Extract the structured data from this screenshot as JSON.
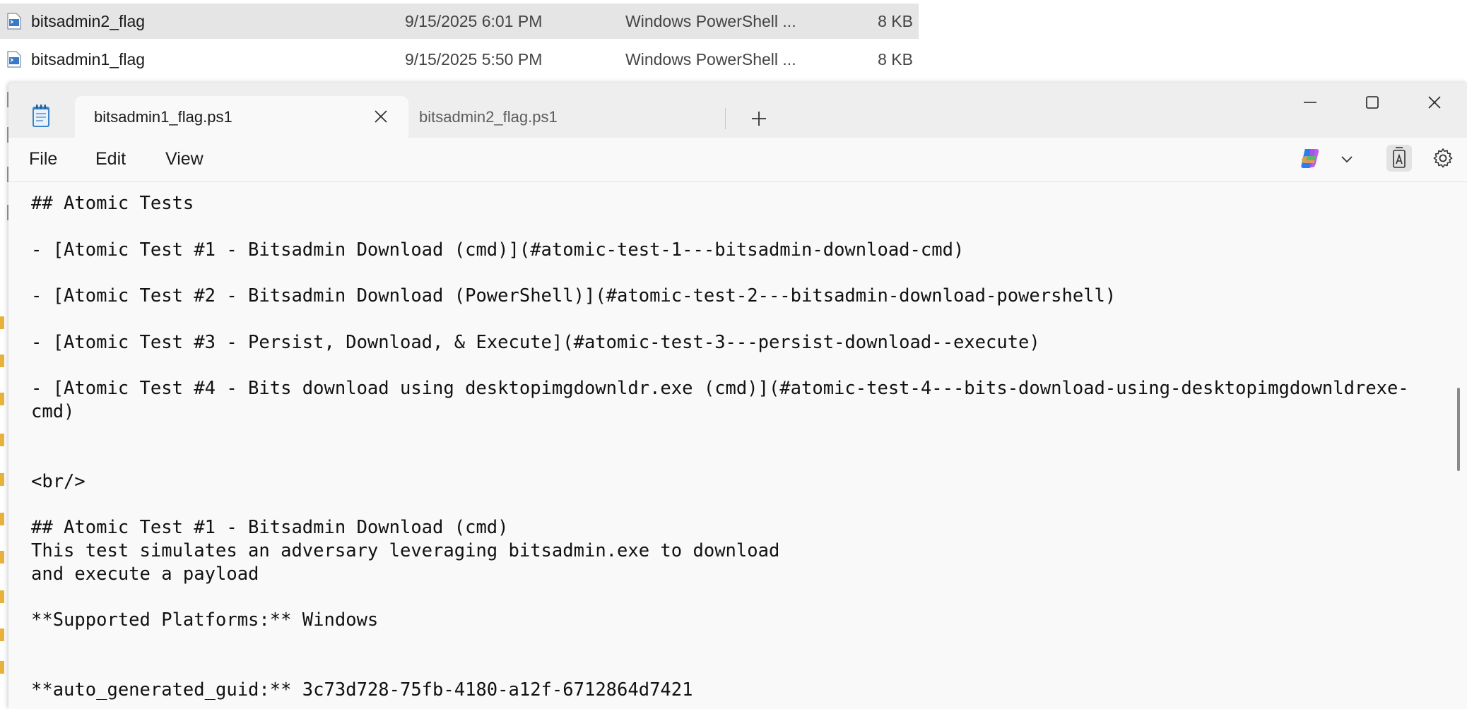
{
  "explorer": {
    "files": [
      {
        "name": "bitsadmin2_flag",
        "date": "9/15/2025 6:01 PM",
        "type": "Windows PowerShell ...",
        "size": "8 KB",
        "selected": true
      },
      {
        "name": "bitsadmin1_flag",
        "date": "9/15/2025 5:50 PM",
        "type": "Windows PowerShell ...",
        "size": "8 KB",
        "selected": false
      }
    ]
  },
  "notepad": {
    "tabs": [
      {
        "label": "bitsadmin1_flag.ps1",
        "active": true
      },
      {
        "label": "bitsadmin2_flag.ps1",
        "active": false
      }
    ],
    "menu": {
      "file": "File",
      "edit": "Edit",
      "view": "View"
    },
    "content": [
      "## Atomic Tests",
      "",
      "- [Atomic Test #1 - Bitsadmin Download (cmd)](#atomic-test-1---bitsadmin-download-cmd)",
      "",
      "- [Atomic Test #2 - Bitsadmin Download (PowerShell)](#atomic-test-2---bitsadmin-download-powershell)",
      "",
      "- [Atomic Test #3 - Persist, Download, & Execute](#atomic-test-3---persist-download--execute)",
      "",
      "- [Atomic Test #4 - Bits download using desktopimgdownldr.exe (cmd)](#atomic-test-4---bits-download-using-desktopimgdownldrexe-",
      "cmd)",
      "",
      "",
      "<br/>",
      "",
      "## Atomic Test #1 - Bitsadmin Download (cmd)",
      "This test simulates an adversary leveraging bitsadmin.exe to download",
      "and execute a payload",
      "",
      "**Supported Platforms:** Windows",
      "",
      "",
      "**auto_generated_guid:** 3c73d728-75fb-4180-a12f-6712864d7421"
    ],
    "colors": {
      "titlebar": "#eeeeee",
      "editor_bg": "#f9f9f9",
      "text": "#111111"
    }
  }
}
